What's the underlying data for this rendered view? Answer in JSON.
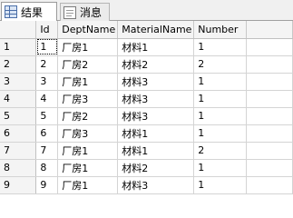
{
  "tabs": [
    {
      "label": "结果",
      "icon": "grid-icon",
      "active": true
    },
    {
      "label": "消息",
      "icon": "message-icon",
      "active": false
    }
  ],
  "columns": [
    "Id",
    "DeptName",
    "MaterialName",
    "Number"
  ],
  "rows": [
    {
      "rownum": "1",
      "cells": [
        "1",
        "厂房1",
        "材料1",
        "1"
      ]
    },
    {
      "rownum": "2",
      "cells": [
        "2",
        "厂房2",
        "材料2",
        "2"
      ]
    },
    {
      "rownum": "3",
      "cells": [
        "3",
        "厂房1",
        "材料3",
        "1"
      ]
    },
    {
      "rownum": "4",
      "cells": [
        "4",
        "厂房3",
        "材料3",
        "1"
      ]
    },
    {
      "rownum": "5",
      "cells": [
        "5",
        "厂房2",
        "材料3",
        "1"
      ]
    },
    {
      "rownum": "6",
      "cells": [
        "6",
        "厂房3",
        "材料1",
        "1"
      ]
    },
    {
      "rownum": "7",
      "cells": [
        "7",
        "厂房1",
        "材料1",
        "2"
      ]
    },
    {
      "rownum": "8",
      "cells": [
        "8",
        "厂房1",
        "材料2",
        "1"
      ]
    },
    {
      "rownum": "9",
      "cells": [
        "9",
        "厂房1",
        "材料3",
        "1"
      ]
    }
  ]
}
